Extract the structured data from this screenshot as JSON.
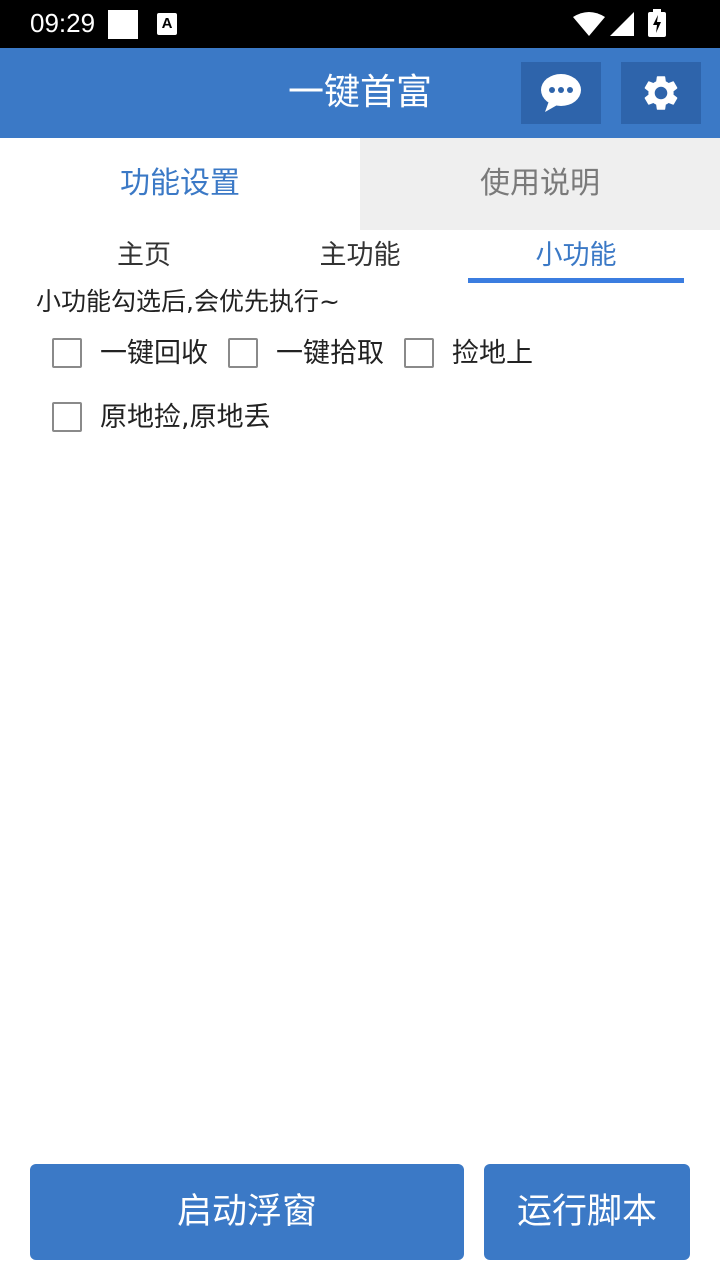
{
  "status_bar": {
    "time": "09:29",
    "notification_icon_letter": "A"
  },
  "app_bar": {
    "title": "一键首富",
    "chat_icon": "chat-bubble-icon",
    "settings_icon": "gear-icon"
  },
  "top_tabs": [
    {
      "label": "功能设置",
      "active": true
    },
    {
      "label": "使用说明",
      "active": false
    }
  ],
  "sub_tabs": [
    {
      "label": "主页",
      "active": false
    },
    {
      "label": "主功能",
      "active": false
    },
    {
      "label": "小功能",
      "active": true
    }
  ],
  "hint": "小功能勾选后,会优先执行~",
  "options": [
    {
      "label": "一键回收",
      "checked": false
    },
    {
      "label": "一键拾取",
      "checked": false
    },
    {
      "label": "捡地上",
      "checked": false
    },
    {
      "label": "原地捡,原地丢",
      "checked": false
    }
  ],
  "buttons": {
    "float_window": "启动浮窗",
    "run_script": "运行脚本"
  },
  "colors": {
    "primary": "#3b79c6",
    "primary_dark": "#2e64ab",
    "tab_inactive_bg": "#efefef",
    "underline": "#3b7de0"
  }
}
